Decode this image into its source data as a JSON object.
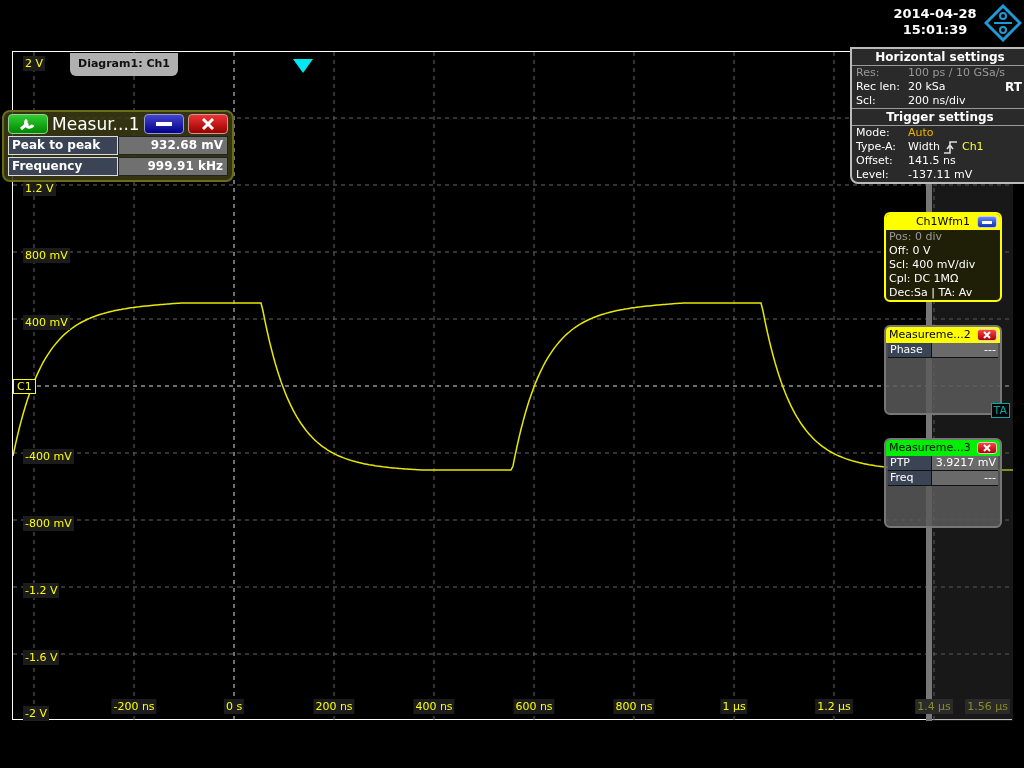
{
  "header": {
    "date": "2014-04-28",
    "time": "15:01:39"
  },
  "diagram": {
    "tab": "Diagram1: Ch1",
    "channel_marker": "C1",
    "trigger_marker": "TA",
    "y_labels": [
      "2 V",
      "1.2 V",
      "800 mV",
      "400 mV",
      "-400 mV",
      "-800 mV",
      "-1.2 V",
      "-1.6 V",
      "-2 V"
    ],
    "x_labels": [
      {
        "text": "-200 ns",
        "dimmed": false
      },
      {
        "text": "0 s",
        "dimmed": false
      },
      {
        "text": "200 ns",
        "dimmed": false
      },
      {
        "text": "400 ns",
        "dimmed": false
      },
      {
        "text": "600 ns",
        "dimmed": false
      },
      {
        "text": "800 ns",
        "dimmed": false
      },
      {
        "text": "1 µs",
        "dimmed": false
      },
      {
        "text": "1.2 µs",
        "dimmed": false
      },
      {
        "text": "1.4 µs",
        "dimmed": true
      },
      {
        "text": "1.56 µs",
        "dimmed": true
      }
    ]
  },
  "measure_panel": {
    "title": "Measur...1",
    "rows": [
      {
        "label": "Peak to peak",
        "value": "932.68 mV"
      },
      {
        "label": "Frequency",
        "value": "999.91 kHz"
      }
    ]
  },
  "horizontal_settings": {
    "title": "Horizontal settings",
    "badge": "RT",
    "rows": [
      {
        "label": "Res:",
        "value": "100 ps / 10 GSa/s",
        "dimmed": true
      },
      {
        "label": "Rec len:",
        "value": "20 kSa",
        "dimmed": false
      },
      {
        "label": "Scl:",
        "value": "200 ns/div",
        "dimmed": false
      }
    ]
  },
  "trigger_settings": {
    "title": "Trigger settings",
    "rows": [
      {
        "label": "Mode:",
        "value": "Auto",
        "color": "#f0b400"
      },
      {
        "label": "Type-A:",
        "value": "Width",
        "source": "Ch1",
        "color": "#ffffff"
      },
      {
        "label": "Offset:",
        "value": "141.5 ns",
        "color": "#ffffff"
      },
      {
        "label": "Level:",
        "value": "-137.11 mV",
        "color": "#ffffff"
      }
    ]
  },
  "channel_panel": {
    "title": "Ch1Wfm1",
    "rows": [
      {
        "text": "Pos: 0 div",
        "dimmed": true
      },
      {
        "text": "Off: 0 V",
        "dimmed": false
      },
      {
        "text": "Scl: 400 mV/div",
        "dimmed": false
      },
      {
        "text": "Cpl: DC 1MΩ",
        "dimmed": false
      },
      {
        "text": "Dec:Sa | TA: Av",
        "dimmed": false
      }
    ]
  },
  "measurement_panels": [
    {
      "title": "Measureme...2",
      "color": "#ffff00",
      "rows": [
        {
          "label": "Phase",
          "value": "---"
        }
      ]
    },
    {
      "title": "Measureme...3",
      "color": "#00ee00",
      "rows": [
        {
          "label": "PTP",
          "value": "3.9217 mV"
        },
        {
          "label": "Freq",
          "value": "---"
        }
      ]
    }
  ]
}
